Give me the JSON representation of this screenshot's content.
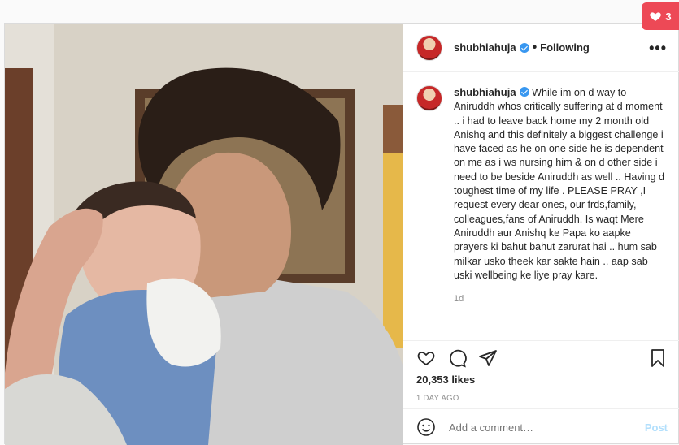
{
  "notification": {
    "count": "3",
    "icon": "heart-icon",
    "color": "#ed4956"
  },
  "post": {
    "username": "shubhiahuja",
    "separator": "•",
    "follow_status": "Following",
    "more_label": "•••",
    "caption": "While im on d way to Aniruddh whos critically suffering at d moment .. i had to leave back home my 2 month old Anishq and this definitely a biggest challenge i have faced as he on one side he is dependent on me as i ws nursing him & on d other side i need to be beside Aniruddh as well .. Having d toughest time of my life . PLEASE PRAY ,I request every dear ones, our frds,family, colleagues,fans of Aniruddh. Is waqt Mere Aniruddh aur Anishq ke Papa ko aapke prayers ki bahut bahut zarurat hai .. hum sab milkar usko theek kar sakte hain .. aap sab uski wellbeing ke liye pray kare.",
    "caption_time": "1d",
    "likes": "20,353 likes",
    "posted_ago": "1 DAY AGO",
    "comment_placeholder": "Add a comment…",
    "post_button": "Post",
    "accent": "#3897f0"
  }
}
